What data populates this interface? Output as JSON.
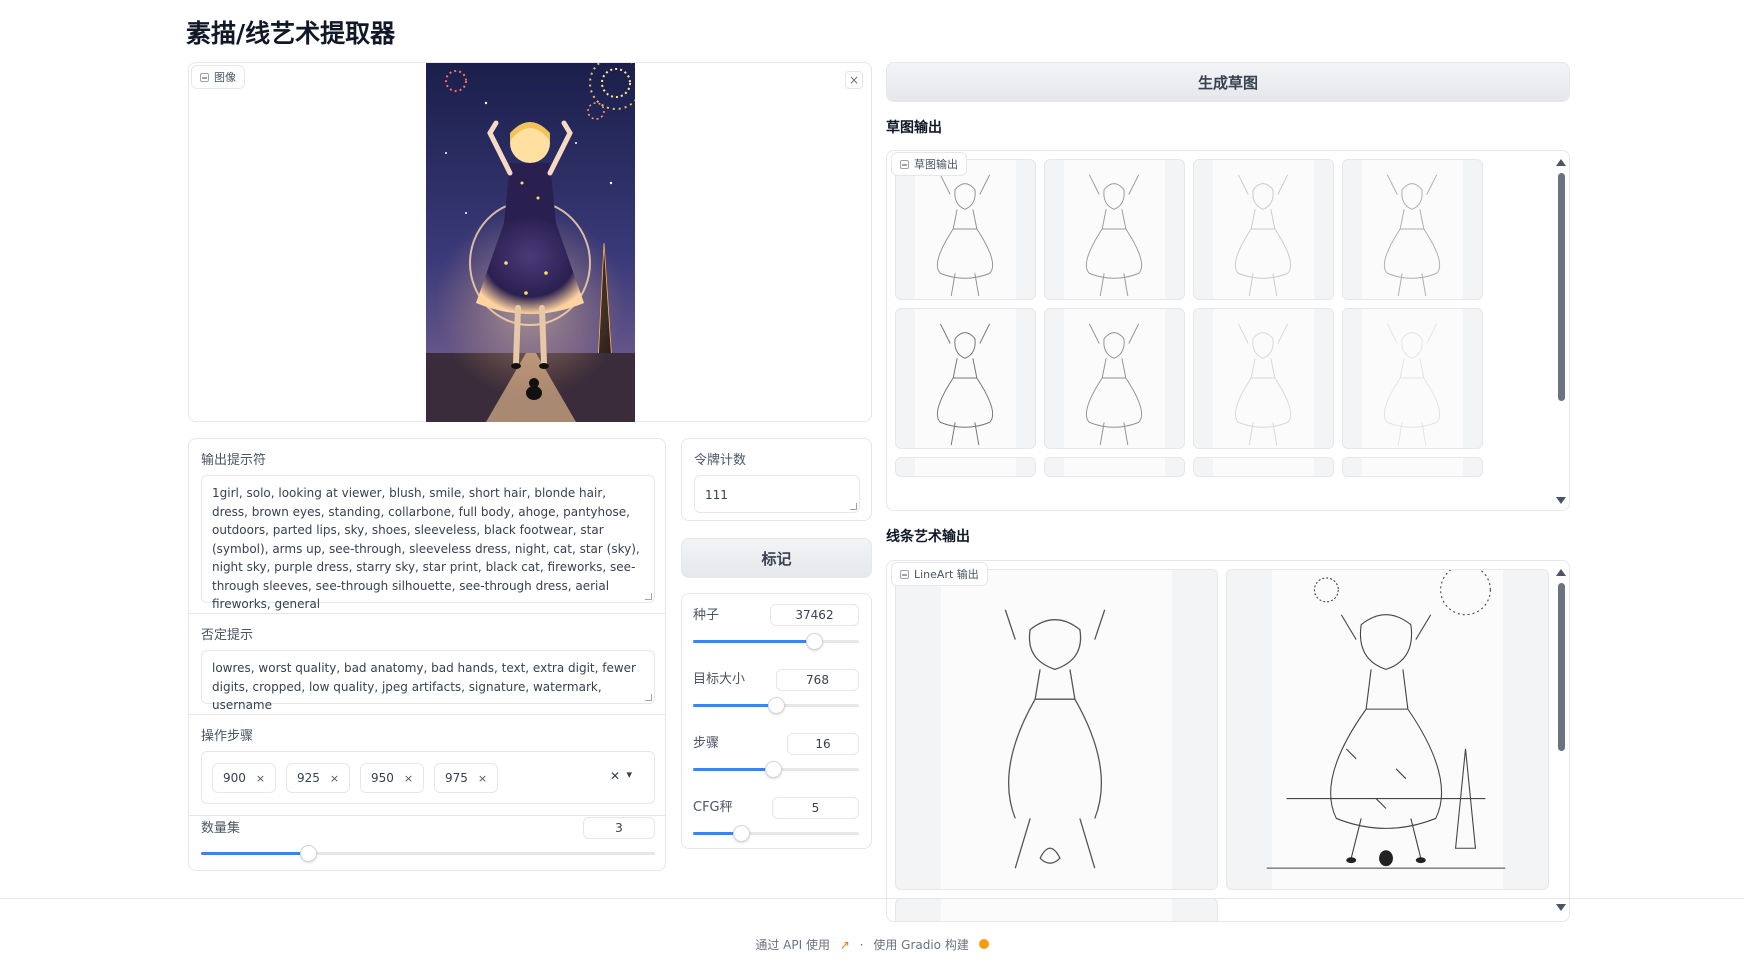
{
  "app": {
    "title": "素描/线艺术提取器"
  },
  "input_image": {
    "label": "图像",
    "close": "×"
  },
  "prompt": {
    "label": "输出提示符",
    "value": "1girl, solo, looking at viewer, blush, smile, short hair, blonde hair, dress, brown eyes, standing, collarbone, full body, ahoge, pantyhose, outdoors, parted lips, sky, shoes, sleeveless, black footwear, star (symbol), arms up, see-through, sleeveless dress, night, cat, star (sky), night sky, purple dress, starry sky, star print, black cat, fireworks, see-through sleeves, see-through silhouette, see-through dress, aerial fireworks, general"
  },
  "negative": {
    "label": "否定提示",
    "value": "lowres, worst quality, bad anatomy, bad hands, text, extra digit, fewer digits, cropped, low quality, jpeg artifacts, signature, watermark, username"
  },
  "steps_multi": {
    "label": "操作步骤",
    "tags": [
      "900",
      "925",
      "950",
      "975"
    ],
    "tag_remove": "×",
    "clear": "✕",
    "dropdown": "▾"
  },
  "quantity": {
    "label": "数量集",
    "value": "3",
    "level": 0.235
  },
  "token_count": {
    "label": "令牌计数",
    "value": "111"
  },
  "tag_button": {
    "label": "标记"
  },
  "seed": {
    "label": "种子",
    "value": "37462",
    "level": 0.73
  },
  "target_size": {
    "label": "目标大小",
    "value": "768",
    "level": 0.5
  },
  "steps": {
    "label": "步骤",
    "value": "16",
    "level": 0.48
  },
  "cfg": {
    "label": "CFG秤",
    "value": "5",
    "level": 0.29
  },
  "generate_button": {
    "label": "生成草图"
  },
  "sketch_output": {
    "title": "草图输出",
    "gallery_label": "草图输出"
  },
  "lineart_output": {
    "title": "线条艺术输出",
    "gallery_label": "LineArt 输出"
  },
  "footer": {
    "api": "通过 API 使用",
    "sep": "·",
    "built": "使用 Gradio 构建"
  },
  "colors": {
    "accent": "#3b82f6",
    "border": "#e5e7eb",
    "button_bg": "#e5e7eb"
  }
}
